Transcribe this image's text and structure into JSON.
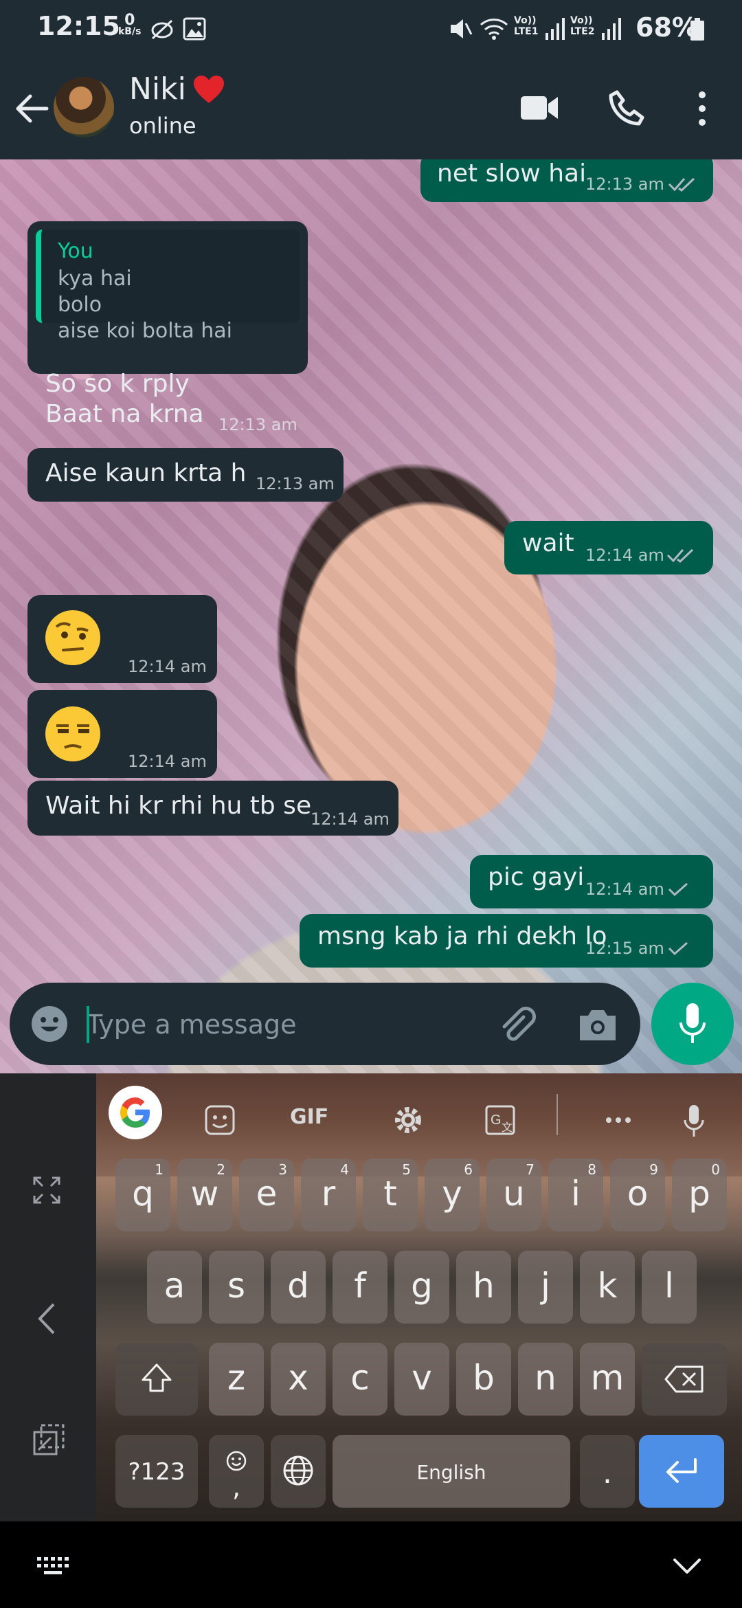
{
  "status_bar": {
    "time": "12:15",
    "net_speed_value": "0",
    "net_speed_unit": "kB/s",
    "sim1_label": "Vo)) LTE1",
    "sim2_label": "Vo)) LTE2",
    "battery": "68%"
  },
  "header": {
    "contact_name": "Niki",
    "status": "online"
  },
  "messages": [
    {
      "dir": "out",
      "text": "net slow hai",
      "time": "12:13 am",
      "ticks": "read"
    },
    {
      "dir": "in",
      "quote_author": "You",
      "quote_lines": [
        "kya hai",
        "bolo",
        "aise koi bolta hai"
      ],
      "lines": [
        "So so k rply",
        "Baat na krna"
      ],
      "time": "12:13 am"
    },
    {
      "dir": "in",
      "text": "Aise kaun krta h",
      "time": "12:13 am"
    },
    {
      "dir": "out",
      "text": "wait",
      "time": "12:14 am",
      "ticks": "read"
    },
    {
      "dir": "in",
      "emoji": "raised-eyebrow-face",
      "time": "12:14 am"
    },
    {
      "dir": "in",
      "emoji": "unamused-face",
      "time": "12:14 am"
    },
    {
      "dir": "in",
      "text": "Wait hi kr rhi hu tb se",
      "time": "12:14 am"
    },
    {
      "dir": "out",
      "text": "pic gayi",
      "time": "12:14 am",
      "ticks": "sent"
    },
    {
      "dir": "out",
      "text": "msng kab ja rhi dekh lo",
      "time": "12:15 am",
      "ticks": "sent"
    }
  ],
  "composer": {
    "placeholder": "Type a message"
  },
  "keyboard": {
    "toolbar": [
      "google-icon",
      "sticker-icon",
      "GIF",
      "gear-icon",
      "translate-icon",
      "more-icon",
      "voice-icon"
    ],
    "row1": [
      {
        "l": "q",
        "n": "1"
      },
      {
        "l": "w",
        "n": "2"
      },
      {
        "l": "e",
        "n": "3"
      },
      {
        "l": "r",
        "n": "4"
      },
      {
        "l": "t",
        "n": "5"
      },
      {
        "l": "y",
        "n": "6"
      },
      {
        "l": "u",
        "n": "7"
      },
      {
        "l": "i",
        "n": "8"
      },
      {
        "l": "o",
        "n": "9"
      },
      {
        "l": "p",
        "n": "0"
      }
    ],
    "row2": [
      "a",
      "s",
      "d",
      "f",
      "g",
      "h",
      "j",
      "k",
      "l"
    ],
    "row3": [
      "z",
      "x",
      "c",
      "v",
      "b",
      "n",
      "m"
    ],
    "symbols_label": "?123",
    "comma_label": ",",
    "space_label": "English",
    "period_label": "."
  },
  "colors": {
    "header_bg": "#1f2c34",
    "incoming_bubble": "#1f2c34",
    "outgoing_bubble": "#005c4b",
    "accent": "#00a884",
    "enter_key": "#4d8fe6"
  }
}
